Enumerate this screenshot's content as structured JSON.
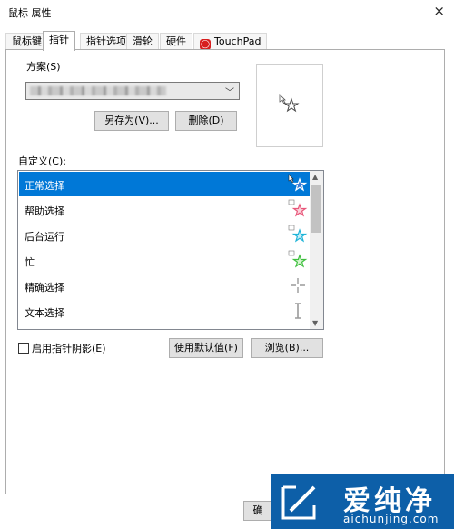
{
  "window": {
    "title": "鼠标 属性",
    "close_glyph": "×"
  },
  "tabs": [
    {
      "label": "鼠标键"
    },
    {
      "label": "指针"
    },
    {
      "label": "指针选项"
    },
    {
      "label": "滑轮"
    },
    {
      "label": "硬件"
    },
    {
      "label": "TouchPad"
    }
  ],
  "scheme": {
    "legend": "方案(S)",
    "save_as": "另存为(V)...",
    "delete": "删除(D)"
  },
  "customize": {
    "label": "自定义(C):",
    "items": [
      {
        "label": "正常选择",
        "icon": "arrow-star-cursor-icon",
        "color": "#3a7bd5"
      },
      {
        "label": "帮助选择",
        "icon": "help-star-cursor-icon",
        "color": "#e8577a"
      },
      {
        "label": "后台运行",
        "icon": "working-star-cursor-icon",
        "color": "#1fb4d8"
      },
      {
        "label": "忙",
        "icon": "busy-star-cursor-icon",
        "color": "#3fbf3f"
      },
      {
        "label": "精确选择",
        "icon": "crosshair-cursor-icon",
        "color": "#9a9a9a"
      },
      {
        "label": "文本选择",
        "icon": "text-beam-cursor-icon",
        "color": "#9a9a9a"
      }
    ]
  },
  "shadow_checkbox": {
    "label": "启用指针阴影(E)"
  },
  "buttons": {
    "use_default": "使用默认值(F)",
    "browse": "浏览(B)...",
    "ok_partial": "确"
  },
  "watermark": {
    "brand_cn": "爱纯净",
    "url": "aichunjing.com"
  },
  "colors": {
    "selection": "#0078d7",
    "watermark_bg": "#0d5fa8"
  }
}
